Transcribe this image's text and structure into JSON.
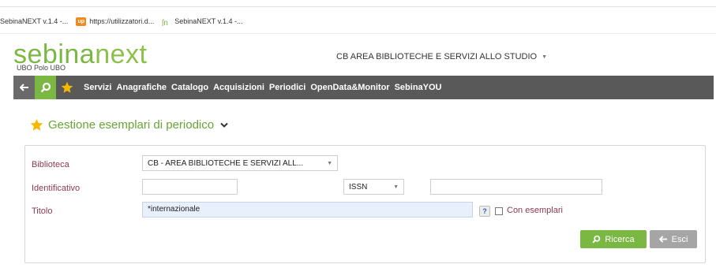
{
  "browser": {
    "bookmarks": [
      {
        "label": "SebinaNEXT v.1.4 -...",
        "icon": "none"
      },
      {
        "label": "https://utilizzatori.d...",
        "icon": "up-icon",
        "icon_text": "up"
      },
      {
        "label": "SebinaNEXT v.1.4 -...",
        "icon": "sn-icon"
      }
    ]
  },
  "header": {
    "logo_part1": "sebina",
    "logo_part2": "next",
    "subtitle": "UBO Polo UBO",
    "area_label": "CB AREA BIBLIOTECHE E SERVIZI ALLO STUDIO",
    "area_caret": "▼"
  },
  "navbar": {
    "items": [
      "Servizi",
      "Anagrafiche",
      "Catalogo",
      "Acquisizioni",
      "Periodici",
      "OpenData&Monitor",
      "SebinaYOU"
    ]
  },
  "page": {
    "title": "Gestione esemplari di periodico"
  },
  "form": {
    "biblioteca_label": "Biblioteca",
    "biblioteca_value": "CB - AREA BIBLIOTECHE E SERVIZI ALL...",
    "identificativo_label": "Identificativo",
    "identificativo_value": "",
    "id_type_value": "ISSN",
    "id_extra_value": "",
    "titolo_label": "Titolo",
    "titolo_value": "*internazionale",
    "help_label": "?",
    "con_esemplari_label": "Con esemplari",
    "con_esemplari_checked": false
  },
  "buttons": {
    "search_label": "Ricerca",
    "exit_label": "Esci"
  },
  "colors": {
    "brand_green": "#7ab743",
    "navbar_bg": "#595959",
    "label_color": "#8b3a4e",
    "star_yellow": "#f5b800"
  }
}
